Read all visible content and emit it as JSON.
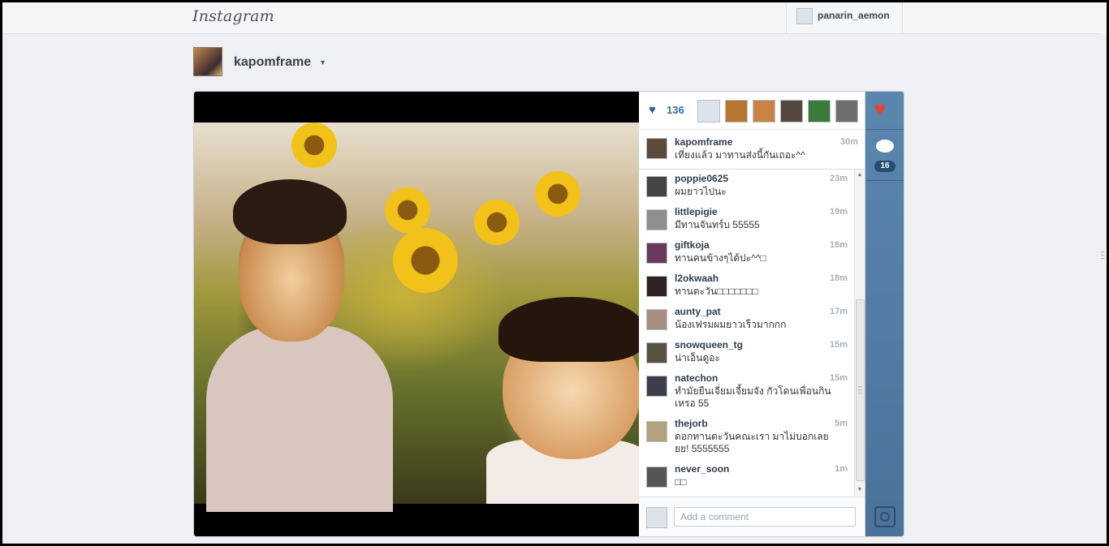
{
  "topbar": {
    "logo": "Instagram",
    "username": "panarin_aemon"
  },
  "owner": {
    "username": "kapomframe",
    "caret": "▾"
  },
  "likes": {
    "count": "136",
    "avatar_colors": [
      "#dde3ea",
      "#b5772f",
      "#c88447",
      "#55483e",
      "#3c7a3c",
      "#6f6f6f"
    ]
  },
  "caption": {
    "user": "kapomframe",
    "text": "เที่ยงแล้ว มาทานส่งนี้กันเถอะ^^",
    "time": "30m"
  },
  "comments": [
    {
      "user": "poppie0625",
      "text": "ผมยาวไปนะ",
      "time": "23m",
      "avatar": "#444444"
    },
    {
      "user": "littlepigie",
      "text": "มีทานจันทร์บ 55555",
      "time": "19m",
      "avatar": "#8e8f91"
    },
    {
      "user": "giftkoja",
      "text": "ทานคนข้างๆได้ปะ^^□",
      "time": "18m",
      "avatar": "#6a3a5c"
    },
    {
      "user": "l2okwaah",
      "text": "ทานตะวัน□□□□□□□",
      "time": "18m",
      "avatar": "#2e2320"
    },
    {
      "user": "aunty_pat",
      "text": "น้องเฟรมผมยาวเร็วมากกก",
      "time": "17m",
      "avatar": "#a88e80"
    },
    {
      "user": "snowqueen_tg",
      "text": "น่าเอ็นดูอะ",
      "time": "15m",
      "avatar": "#5a5240"
    },
    {
      "user": "natechon",
      "text": "ทำมัยยืนเจี่ยมเจี้ยมจัง กัวโดนเพื่อนกินเหรอ 55",
      "time": "15m",
      "avatar": "#3c3f4b"
    },
    {
      "user": "thejorb",
      "text": "ดอกทานตะวันคณะเรา มาไม่บอกเลยยย! 5555555",
      "time": "5m",
      "avatar": "#b3a27d"
    },
    {
      "user": "never_soon",
      "text": "□□",
      "time": "1m",
      "avatar": "#555555"
    }
  ],
  "comment_input": {
    "placeholder": "Add a comment",
    "value": ""
  },
  "rail": {
    "comment_count": "16"
  },
  "colors": {
    "accent": "#4a739a",
    "heart": "#e0463c",
    "link": "#3b6b9c"
  }
}
